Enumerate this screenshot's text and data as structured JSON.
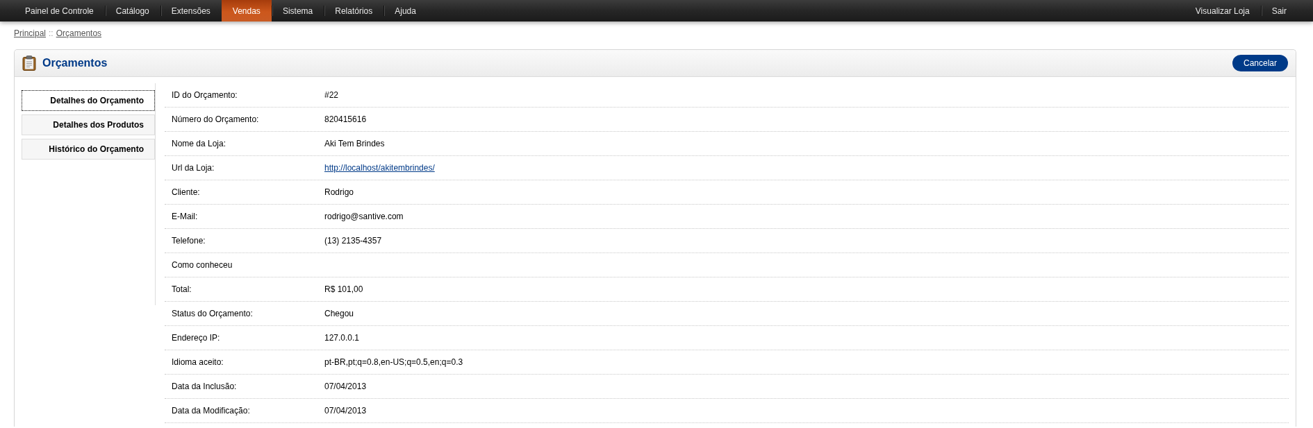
{
  "top_nav": {
    "items": [
      {
        "label": "Painel de Controle",
        "selected": false
      },
      {
        "label": "Catálogo",
        "selected": false
      },
      {
        "label": "Extensões",
        "selected": false
      },
      {
        "label": "Vendas",
        "selected": true
      },
      {
        "label": "Sistema",
        "selected": false
      },
      {
        "label": "Relatórios",
        "selected": false
      },
      {
        "label": "Ajuda",
        "selected": false
      }
    ],
    "right_items": [
      "Visualizar Loja",
      "Sair"
    ]
  },
  "breadcrumb": {
    "links": [
      "Principal",
      "Orçamentos"
    ],
    "separator": "::"
  },
  "panel": {
    "title": "Orçamentos",
    "cancel_button": "Cancelar",
    "tabs": [
      {
        "label": "Detalhes do Orçamento",
        "selected": true
      },
      {
        "label": "Detalhes dos Produtos",
        "selected": false
      },
      {
        "label": "Histórico do Orçamento",
        "selected": false
      }
    ],
    "details": [
      {
        "kind": "text",
        "label": "ID do Orçamento:",
        "value": "#22"
      },
      {
        "kind": "text",
        "label": "Número do Orçamento:",
        "value": "820415616"
      },
      {
        "kind": "text",
        "label": "Nome da Loja:",
        "value": "Aki Tem Brindes"
      },
      {
        "kind": "link",
        "label": "Url da Loja:",
        "value": "http://localhost/akitembrindes/"
      },
      {
        "kind": "text",
        "label": "Cliente:",
        "value": "Rodrigo"
      },
      {
        "kind": "text",
        "label": "E-Mail:",
        "value": "rodrigo@santive.com"
      },
      {
        "kind": "text",
        "label": "Telefone:",
        "value": "(13) 2135-4357"
      },
      {
        "kind": "text",
        "label": "Como conheceu"
      },
      {
        "kind": "text",
        "label": "Total:",
        "value": "R$ 101,00"
      },
      {
        "kind": "text",
        "label": "Status do Orçamento:",
        "value": "Chegou"
      },
      {
        "kind": "text",
        "label": "Endereço IP:",
        "value": "127.0.0.1"
      },
      {
        "kind": "text",
        "label": "Idioma aceito:",
        "value": "pt-BR,pt;q=0.8,en-US;q=0.5,en;q=0.3"
      },
      {
        "kind": "text",
        "label": "Data da Inclusão:",
        "value": "07/04/2013"
      },
      {
        "kind": "text",
        "label": "Data da Modificação:",
        "value": "07/04/2013"
      }
    ]
  }
}
